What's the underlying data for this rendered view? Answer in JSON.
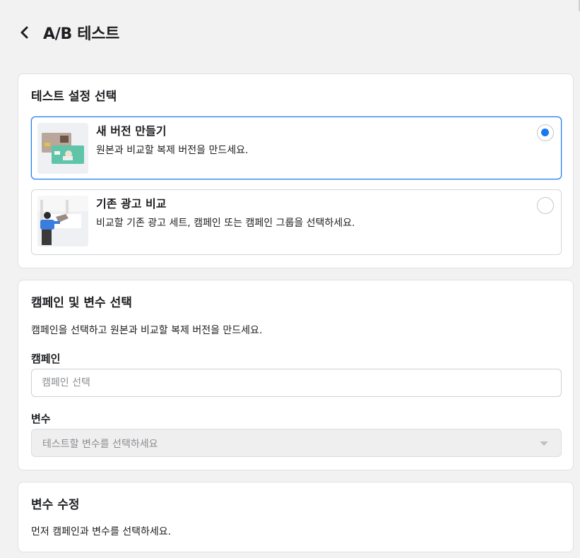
{
  "header": {
    "title": "A/B 테스트",
    "back_icon": "chevron-left-icon"
  },
  "test_setup": {
    "title": "테스트 설정 선택",
    "options": [
      {
        "title": "새 버전 만들기",
        "description": "원본과 비교할 복제 버전을 만드세요.",
        "selected": true
      },
      {
        "title": "기존 광고 비교",
        "description": "비교할 기존 광고 세트, 캠페인 또는 캠페인 그룹을 선택하세요.",
        "selected": false
      }
    ]
  },
  "campaign_section": {
    "title": "캠페인 및 변수 선택",
    "description": "캠페인을 선택하고 원본과 비교할 복제 버전을 만드세요.",
    "campaign_label": "캠페인",
    "campaign_placeholder": "캠페인 선택",
    "variable_label": "변수",
    "variable_placeholder": "테스트할 변수를 선택하세요"
  },
  "edit_section": {
    "title": "변수 수정",
    "description": "먼저 캠페인과 변수를 선택하세요."
  },
  "colors": {
    "accent": "#1877f2",
    "background": "#f2f2f2"
  }
}
